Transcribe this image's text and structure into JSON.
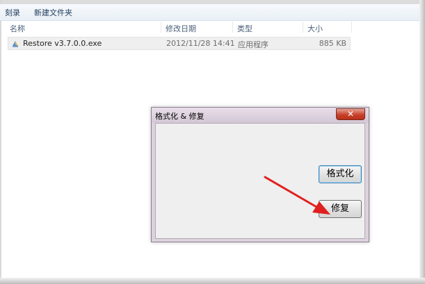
{
  "toolbar": {
    "burn_label": "刻录",
    "new_folder_label": "新建文件夹"
  },
  "columns": {
    "name": "名称",
    "date_modified": "修改日期",
    "type": "类型",
    "size": "大小"
  },
  "files": [
    {
      "name": "Restore v3.7.0.0.exe",
      "date_modified": "2012/11/28 14:41",
      "type": "应用程序",
      "size": "885 KB",
      "icon": "executable-icon"
    }
  ],
  "dialog": {
    "title": "格式化 & 修复",
    "close_glyph": "✕",
    "buttons": {
      "format_label": "格式化",
      "repair_label": "修复"
    }
  },
  "annotation": {
    "arrow_color": "#e02020"
  }
}
